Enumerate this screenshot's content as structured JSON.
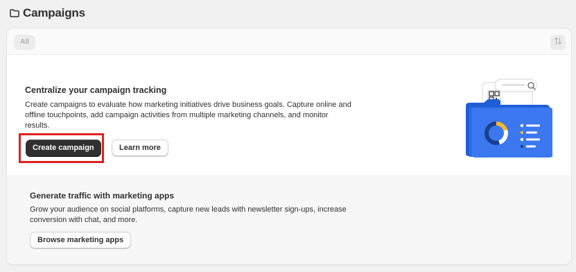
{
  "header": {
    "title": "Campaigns",
    "icon": "folder-icon"
  },
  "toolbar": {
    "tab_all": "All",
    "sort_icon": "sort-arrows-icon"
  },
  "empty_state": {
    "title": "Centralize your campaign tracking",
    "description": "Create campaigns to evaluate how marketing initiatives drive business goals. Capture online and offline touchpoints, add campaign activities from multiple marketing channels, and monitor results.",
    "primary_button": "Create campaign",
    "secondary_button": "Learn more",
    "illustration": "folder-analytics-illustration",
    "highlight_color": "#e02020"
  },
  "marketing_apps": {
    "title": "Generate traffic with marketing apps",
    "description": "Grow your audience on social platforms, capture new leads with newsletter sign-ups, increase conversion with chat, and more.",
    "button": "Browse marketing apps"
  },
  "colors": {
    "primary_button": "#303030",
    "folder_blue": "#2f6ee8",
    "accent_yellow": "#f5b82e"
  }
}
